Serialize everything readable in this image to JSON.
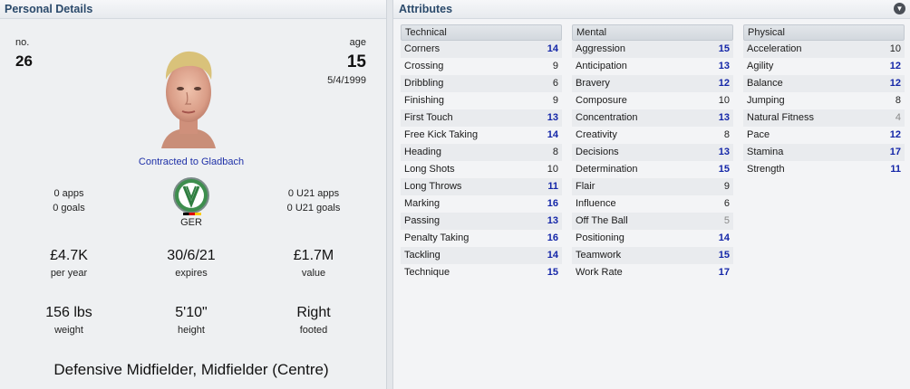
{
  "personal": {
    "title": "Personal Details",
    "no_label": "no.",
    "no_value": "26",
    "age_label": "age",
    "age_value": "15",
    "dob": "5/4/1999",
    "contract": "Contracted to Gladbach",
    "apps": "0 apps",
    "goals": "0 goals",
    "nation": "GER",
    "u21_apps": "0 U21 apps",
    "u21_goals": "0 U21 goals",
    "wage_value": "£4.7K",
    "wage_label": "per year",
    "expires_value": "30/6/21",
    "expires_label": "expires",
    "value_value": "£1.7M",
    "value_label": "value",
    "weight_value": "156 lbs",
    "weight_label": "weight",
    "height_value": "5'10\"",
    "height_label": "height",
    "foot_value": "Right",
    "foot_label": "footed",
    "positions": "Defensive Midfielder, Midfielder (Centre)"
  },
  "attributes": {
    "title": "Attributes",
    "colors": {
      "high": "#1426a8",
      "mid": "#222222",
      "low": "#888888"
    },
    "technical": {
      "title": "Technical",
      "rows": [
        {
          "name": "Corners",
          "value": "14",
          "tier": "high"
        },
        {
          "name": "Crossing",
          "value": "9",
          "tier": "mid"
        },
        {
          "name": "Dribbling",
          "value": "6",
          "tier": "mid"
        },
        {
          "name": "Finishing",
          "value": "9",
          "tier": "mid"
        },
        {
          "name": "First Touch",
          "value": "13",
          "tier": "high"
        },
        {
          "name": "Free Kick Taking",
          "value": "14",
          "tier": "high"
        },
        {
          "name": "Heading",
          "value": "8",
          "tier": "mid"
        },
        {
          "name": "Long Shots",
          "value": "10",
          "tier": "mid"
        },
        {
          "name": "Long Throws",
          "value": "11",
          "tier": "high"
        },
        {
          "name": "Marking",
          "value": "16",
          "tier": "high"
        },
        {
          "name": "Passing",
          "value": "13",
          "tier": "high"
        },
        {
          "name": "Penalty Taking",
          "value": "16",
          "tier": "high"
        },
        {
          "name": "Tackling",
          "value": "14",
          "tier": "high"
        },
        {
          "name": "Technique",
          "value": "15",
          "tier": "high"
        }
      ]
    },
    "mental": {
      "title": "Mental",
      "rows": [
        {
          "name": "Aggression",
          "value": "15",
          "tier": "high"
        },
        {
          "name": "Anticipation",
          "value": "13",
          "tier": "high"
        },
        {
          "name": "Bravery",
          "value": "12",
          "tier": "high"
        },
        {
          "name": "Composure",
          "value": "10",
          "tier": "mid"
        },
        {
          "name": "Concentration",
          "value": "13",
          "tier": "high"
        },
        {
          "name": "Creativity",
          "value": "8",
          "tier": "mid"
        },
        {
          "name": "Decisions",
          "value": "13",
          "tier": "high"
        },
        {
          "name": "Determination",
          "value": "15",
          "tier": "high"
        },
        {
          "name": "Flair",
          "value": "9",
          "tier": "mid"
        },
        {
          "name": "Influence",
          "value": "6",
          "tier": "mid"
        },
        {
          "name": "Off The Ball",
          "value": "5",
          "tier": "low"
        },
        {
          "name": "Positioning",
          "value": "14",
          "tier": "high"
        },
        {
          "name": "Teamwork",
          "value": "15",
          "tier": "high"
        },
        {
          "name": "Work Rate",
          "value": "17",
          "tier": "high"
        }
      ]
    },
    "physical": {
      "title": "Physical",
      "rows": [
        {
          "name": "Acceleration",
          "value": "10",
          "tier": "mid"
        },
        {
          "name": "Agility",
          "value": "12",
          "tier": "high"
        },
        {
          "name": "Balance",
          "value": "12",
          "tier": "high"
        },
        {
          "name": "Jumping",
          "value": "8",
          "tier": "mid"
        },
        {
          "name": "Natural Fitness",
          "value": "4",
          "tier": "low"
        },
        {
          "name": "Pace",
          "value": "12",
          "tier": "high"
        },
        {
          "name": "Stamina",
          "value": "17",
          "tier": "high"
        },
        {
          "name": "Strength",
          "value": "11",
          "tier": "high"
        }
      ]
    }
  }
}
